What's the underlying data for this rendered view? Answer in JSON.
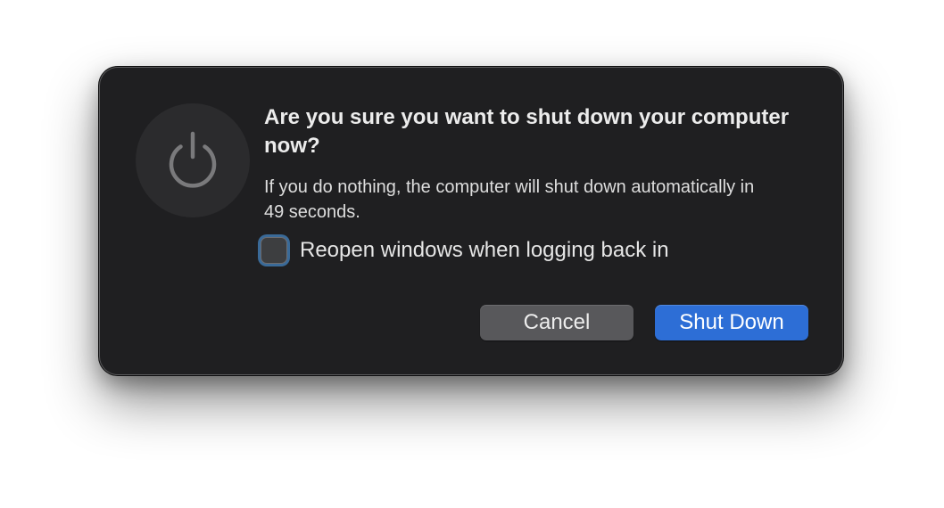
{
  "dialog": {
    "icon": "power-icon",
    "title": "Are you sure you want to shut down your computer now?",
    "message": "If you do nothing, the computer will shut down automatically in 49 seconds.",
    "countdown_seconds": 49,
    "checkbox": {
      "label": "Reopen windows when logging back in",
      "checked": false
    },
    "buttons": {
      "cancel_label": "Cancel",
      "primary_label": "Shut Down"
    }
  },
  "colors": {
    "dialog_background": "#1f1f21",
    "primary_button": "#2d6ed6",
    "secondary_button": "#58585b",
    "focus_ring": "#3a6a98"
  }
}
